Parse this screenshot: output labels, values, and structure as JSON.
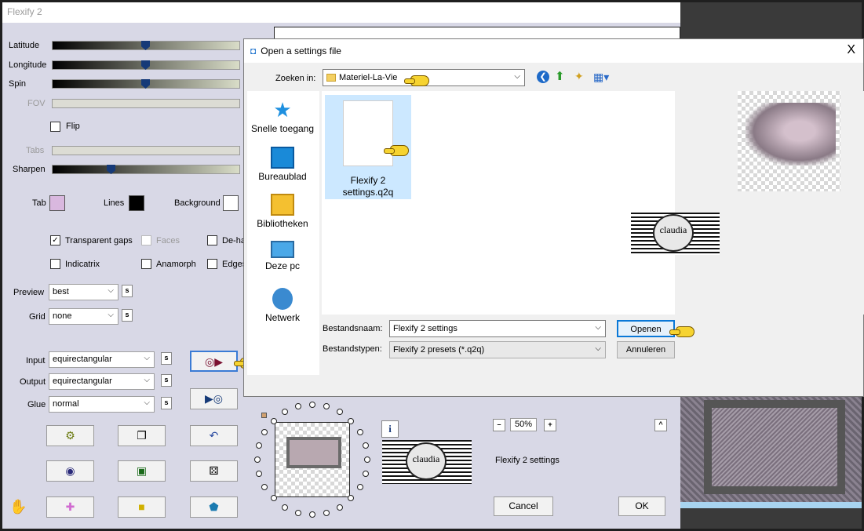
{
  "app": {
    "title": "Flexify 2",
    "sliders": [
      {
        "label": "Latitude",
        "value_fraction": 0.5,
        "enabled": true
      },
      {
        "label": "Longitude",
        "value_fraction": 0.5,
        "enabled": true
      },
      {
        "label": "Spin",
        "value_fraction": 0.5,
        "enabled": true
      },
      {
        "label": "FOV",
        "value_fraction": null,
        "enabled": false
      },
      {
        "label": "Tabs",
        "value_fraction": null,
        "enabled": false
      },
      {
        "label": "Sharpen",
        "value_fraction": 0.31,
        "enabled": true
      }
    ],
    "flip_label": "Flip",
    "colors": {
      "tab_label": "Tab",
      "tab_color": "#d9b8df",
      "lines_label": "Lines",
      "lines_color": "#000000",
      "background_label": "Background",
      "background_color": "#ffffff"
    },
    "options": {
      "transparent_gaps": {
        "label": "Transparent gaps",
        "checked": true
      },
      "faces": {
        "label": "Faces",
        "checked": false,
        "enabled": false
      },
      "dehalo": {
        "label": "De-ha",
        "checked": false
      },
      "indicatrix": {
        "label": "Indicatrix",
        "checked": false
      },
      "anamorph": {
        "label": "Anamorph",
        "checked": false
      },
      "edges": {
        "label": "Edges",
        "checked": false
      }
    },
    "preview": {
      "label": "Preview",
      "value": "best"
    },
    "grid": {
      "label": "Grid",
      "value": "none"
    },
    "input": {
      "label": "Input",
      "value": "equirectangular"
    },
    "output": {
      "label": "Output",
      "value": "equirectangular"
    },
    "glue": {
      "label": "Glue",
      "value": "normal"
    },
    "s_button_label": "s",
    "zoom": {
      "minus": "–",
      "value": "50%",
      "plus": "+"
    },
    "info_label": "i",
    "up_label": "^",
    "settings_name": "Flexify 2 settings",
    "cancel_label": "Cancel",
    "ok_label": "OK",
    "icon_buttons": [
      "load-settings-icon",
      "save-settings-icon",
      "gear-icon",
      "copy-icon",
      "undo-icon",
      "ring-icon",
      "square-icon",
      "dice-icon",
      "cross-icon",
      "cube-icon",
      "gem-icon",
      "app-logo-icon"
    ]
  },
  "dialog": {
    "title": "Open a settings file",
    "close_label": "X",
    "look_in_label": "Zoeken in:",
    "look_in_value": "Materiel-La-Vie",
    "nav_items": [
      "Snelle toegang",
      "Bureaublad",
      "Bibliotheken",
      "Deze pc",
      "Netwerk"
    ],
    "file": {
      "name_line1": "Flexify 2",
      "name_line2": "settings.q2q"
    },
    "filename_label": "Bestandsnaam:",
    "filename_value": "Flexify 2 settings",
    "filetype_label": "Bestandstypen:",
    "filetype_value": "Flexify 2 presets (*.q2q)",
    "open_label": "Openen",
    "cancel_label": "Annuleren",
    "watermark_text": "claudia"
  }
}
